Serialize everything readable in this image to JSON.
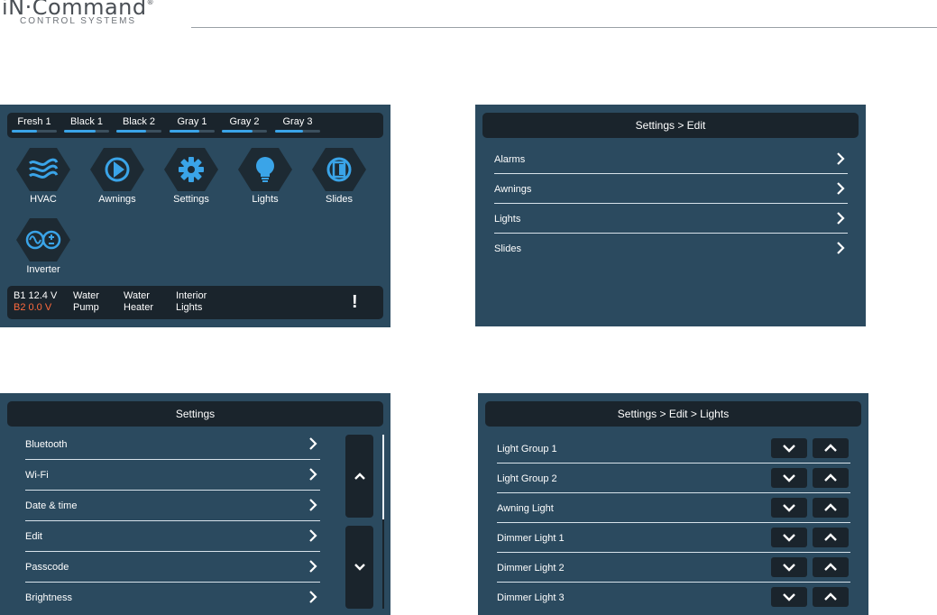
{
  "brand": {
    "name": "iN·Command",
    "registered": "®",
    "tagline": "CONTROL SYSTEMS"
  },
  "colors": {
    "panel_bg": "#2b4a5f",
    "bar_bg": "#1a242c",
    "accent_blue": "#3aa4e8",
    "warning_red": "#ff6a3d"
  },
  "home": {
    "tanks": [
      {
        "label": "Fresh 1",
        "level": 0.55
      },
      {
        "label": "Black 1",
        "level": 0.7
      },
      {
        "label": "Black 2",
        "level": 0.65
      },
      {
        "label": "Gray 1",
        "level": 0.65
      },
      {
        "label": "Gray 2",
        "level": 0.68
      },
      {
        "label": "Gray 3",
        "level": 0.62
      }
    ],
    "tiles": [
      {
        "label": "HVAC",
        "icon": "hvac-icon"
      },
      {
        "label": "Awnings",
        "icon": "awning-icon"
      },
      {
        "label": "Settings",
        "icon": "gear-icon"
      },
      {
        "label": "Lights",
        "icon": "lightbulb-icon"
      },
      {
        "label": "Slides",
        "icon": "slide-icon"
      },
      {
        "label": "Inverter",
        "icon": "inverter-icon"
      }
    ],
    "status": {
      "b1": "B1 12.4 V",
      "b2": "B2  0.0 V",
      "water_pump": [
        "Water",
        "Pump"
      ],
      "water_heater": [
        "Water",
        "Heater"
      ],
      "interior_lights": [
        "Interior",
        "Lights"
      ],
      "alert": "!"
    }
  },
  "settings_edit": {
    "title": "Settings > Edit",
    "items": [
      "Alarms",
      "Awnings",
      "Lights",
      "Slides"
    ]
  },
  "settings": {
    "title": "Settings",
    "items": [
      "Bluetooth",
      "Wi-Fi",
      "Date & time",
      "Edit",
      "Passcode",
      "Brightness"
    ]
  },
  "settings_edit_lights": {
    "title": "Settings > Edit > Lights",
    "items": [
      "Light Group 1",
      "Light Group 2",
      "Awning Light",
      "Dimmer Light 1",
      "Dimmer Light 2",
      "Dimmer Light 3"
    ]
  }
}
